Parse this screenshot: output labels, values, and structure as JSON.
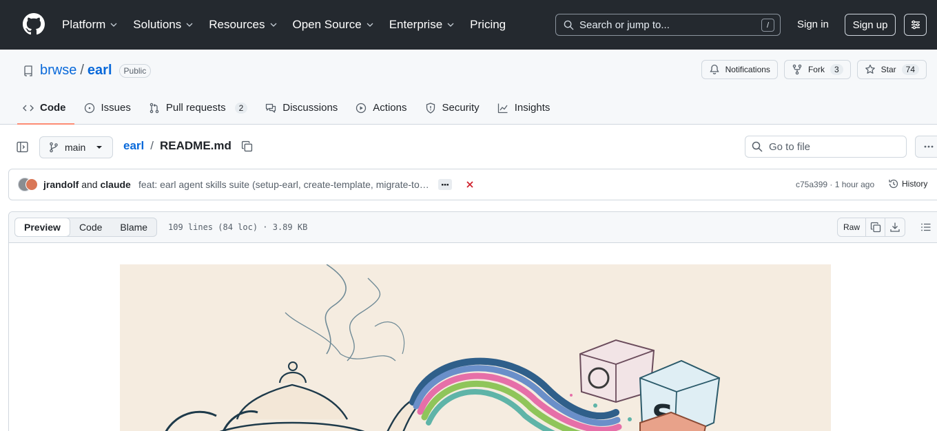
{
  "header": {
    "nav": [
      {
        "label": "Platform",
        "has_menu": true
      },
      {
        "label": "Solutions",
        "has_menu": true
      },
      {
        "label": "Resources",
        "has_menu": true
      },
      {
        "label": "Open Source",
        "has_menu": true
      },
      {
        "label": "Enterprise",
        "has_menu": true
      },
      {
        "label": "Pricing",
        "has_menu": false
      }
    ],
    "search_placeholder": "Search or jump to...",
    "search_key": "/",
    "sign_in": "Sign in",
    "sign_up": "Sign up"
  },
  "repo": {
    "owner": "brwse",
    "separator": "/",
    "name": "earl",
    "visibility": "Public",
    "actions": {
      "notifications": "Notifications",
      "fork_label": "Fork",
      "fork_count": "3",
      "star_label": "Star",
      "star_count": "74"
    },
    "tabs": [
      {
        "label": "Code",
        "icon": "code-icon",
        "active": true
      },
      {
        "label": "Issues",
        "icon": "issue-icon"
      },
      {
        "label": "Pull requests",
        "icon": "pull-request-icon",
        "count": "2"
      },
      {
        "label": "Discussions",
        "icon": "discussion-icon"
      },
      {
        "label": "Actions",
        "icon": "play-icon"
      },
      {
        "label": "Security",
        "icon": "shield-icon"
      },
      {
        "label": "Insights",
        "icon": "graph-icon"
      }
    ]
  },
  "filenav": {
    "branch": "main",
    "path_repo": "earl",
    "path_sep": "/",
    "file_name": "README.md",
    "goto_placeholder": "Go to file"
  },
  "commit": {
    "author1": "jrandolf",
    "joiner": "and",
    "author2": "claude",
    "message": "feat: earl agent skills suite (setup-earl, create-template, migrate-to-earl, troubleshoot-earl, secure-agent)",
    "sha": "c75a399",
    "meta_sep": "·",
    "time": "1 hour ago",
    "history_label": "History",
    "status": "failed"
  },
  "fileview": {
    "tabs": [
      "Preview",
      "Code",
      "Blame"
    ],
    "active_tab": "Preview",
    "info": "109 lines (84 loc) · 3.89 KB",
    "raw_label": "Raw"
  },
  "colors": {
    "header_bg": "#24292f",
    "link": "#0969da",
    "active_tab_underline": "#fd8c73",
    "fail_red": "#cf222e",
    "hero_bg": "#f5ece0"
  }
}
